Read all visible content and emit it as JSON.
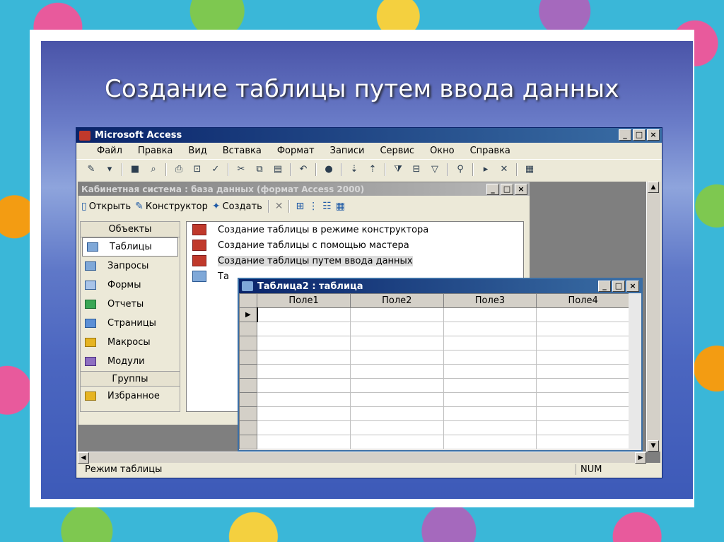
{
  "slide": {
    "title": "Создание таблицы путем ввода данных"
  },
  "app": {
    "title": "Microsoft Access",
    "menu": [
      "Файл",
      "Правка",
      "Вид",
      "Вставка",
      "Формат",
      "Записи",
      "Сервис",
      "Окно",
      "Справка"
    ],
    "status": "Режим таблицы",
    "num": "NUM"
  },
  "db": {
    "title": "Кабинетная система : база данных (формат Access 2000)",
    "toolbar": {
      "open": "Открыть",
      "design": "Конструктор",
      "create": "Создать"
    },
    "objects_header": "Объекты",
    "objects": [
      "Таблицы",
      "Запросы",
      "Формы",
      "Отчеты",
      "Страницы",
      "Макросы",
      "Модули"
    ],
    "groups_header": "Группы",
    "favorites": "Избранное",
    "list": [
      "Создание таблицы в режиме конструктора",
      "Создание таблицы с помощью мастера",
      "Создание таблицы путем ввода данных",
      "Та"
    ]
  },
  "table": {
    "title": "Таблица2 : таблица",
    "columns": [
      "Поле1",
      "Поле2",
      "Поле3",
      "Поле4"
    ]
  },
  "window_buttons": {
    "minimize": "_",
    "maximize": "□",
    "close": "×"
  }
}
